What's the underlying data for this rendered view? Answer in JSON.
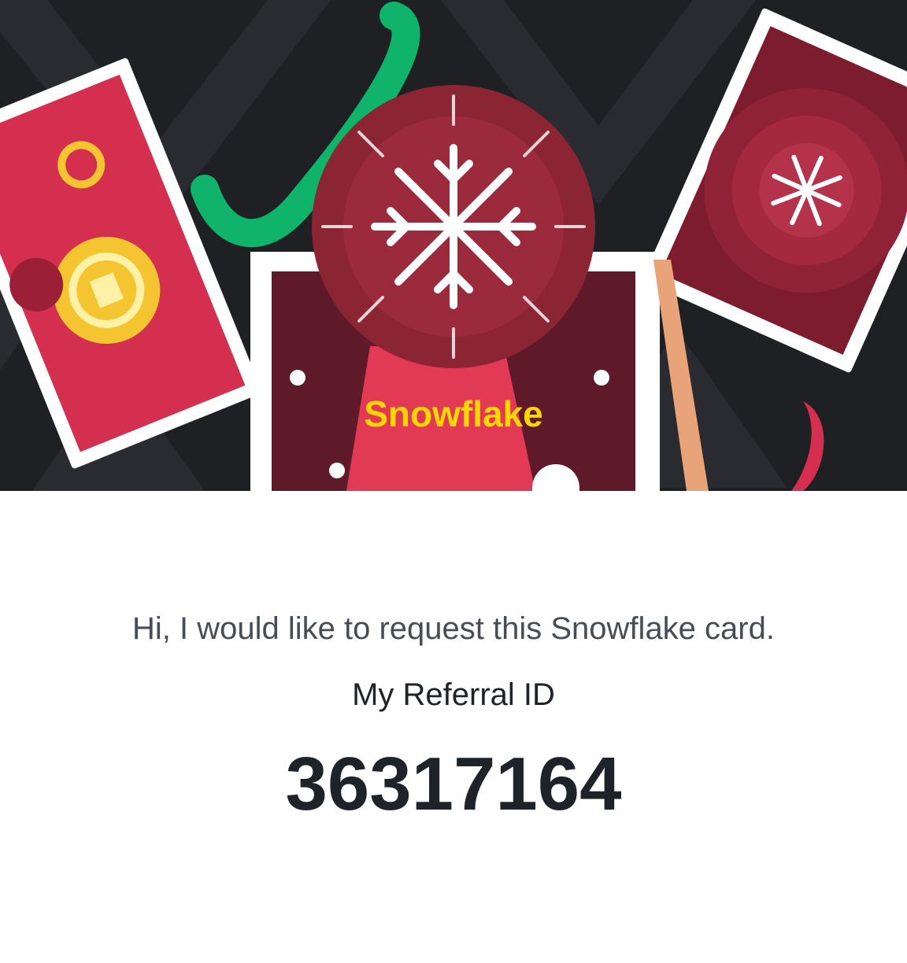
{
  "card": {
    "name": "Snowflake",
    "title_color": "#ffd700",
    "banner_background": "#1f2024",
    "medal_color": "#8b2433",
    "icon": "snowflake-icon"
  },
  "request": {
    "message": "Hi, I would like to request this Snowflake card."
  },
  "referral": {
    "label": "My Referral ID",
    "id": "36317164"
  }
}
